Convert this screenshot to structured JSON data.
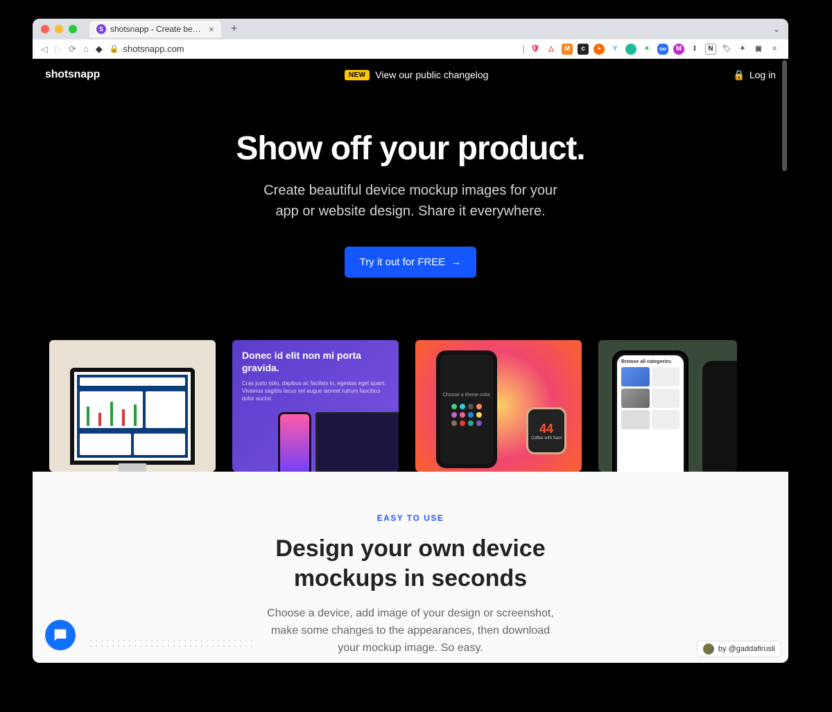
{
  "browser": {
    "tab_title": "shotsnapp - Create beautiful de",
    "url": "shotsnapp.com"
  },
  "nav": {
    "logo": "shotsnapp",
    "new_badge": "NEW",
    "changelog_text": "View our public changelog",
    "login": "Log in"
  },
  "hero": {
    "headline": "Show off your product.",
    "sub1": "Create beautiful device mockup images for your",
    "sub2": "app or website design. Share it everywhere.",
    "cta": "Try it out for FREE"
  },
  "gallery": {
    "card2_heading": "Donec id elit non mi porta gravida.",
    "card2_body": "Cras justo odio, dapibus ac facilisis in, egestas eget quam. Vivamus sagittis lacus vel augue laoreet rutrum faucibus dolor auctor.",
    "card3_watch_num": "44",
    "card3_watch_label": "Coffee with Sam",
    "card4_header": "Browse all categories"
  },
  "section2": {
    "eyebrow": "EASY TO USE",
    "heading1": "Design your own device",
    "heading2": "mockups in seconds",
    "body1": "Choose a device, add image of your design or screenshot,",
    "body2": "make some changes to the appearances, then download",
    "body3": "your mockup image. So easy."
  },
  "attribution": {
    "text": "by @gaddafirusli"
  }
}
